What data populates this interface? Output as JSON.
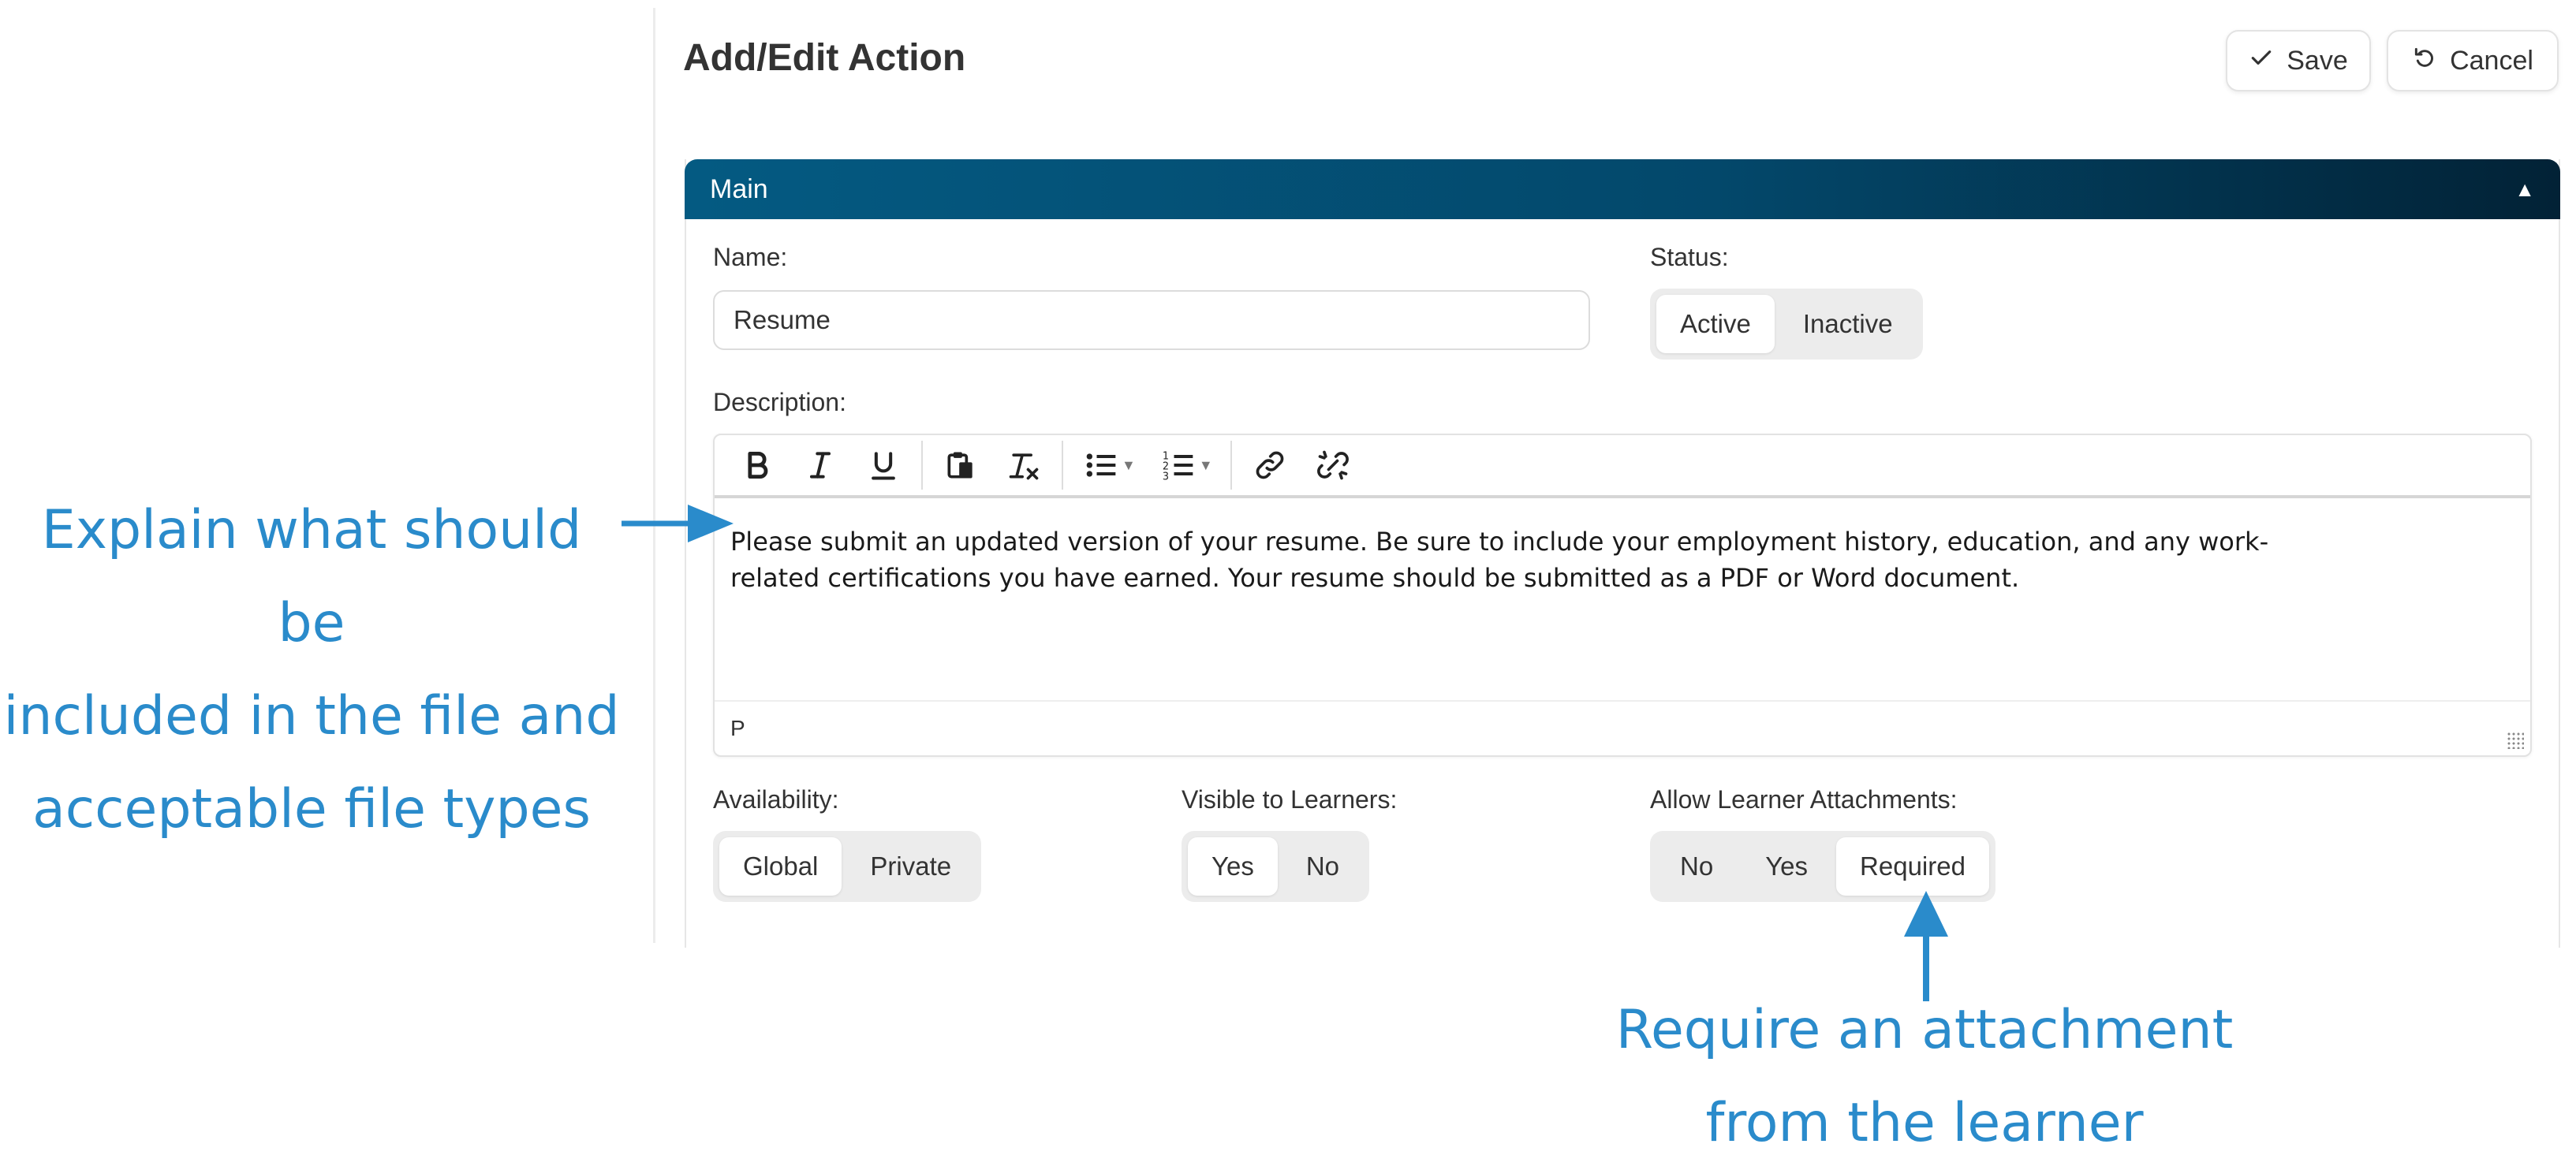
{
  "page": {
    "title": "Add/Edit Action"
  },
  "toolbar": {
    "save_label": "Save",
    "cancel_label": "Cancel"
  },
  "card": {
    "header": "Main"
  },
  "name": {
    "label": "Name:",
    "value": "Resume"
  },
  "status": {
    "label": "Status:",
    "options": [
      "Active",
      "Inactive"
    ],
    "selected": "Active"
  },
  "description": {
    "label": "Description:",
    "text_line1": "Please submit an updated version of your resume. Be sure to include your employment history, education, and any work-",
    "text_line2": "related certifications you have earned. Your resume should be submitted as a PDF or Word document.",
    "status_path": "P",
    "toolbar_icons": [
      "bold-icon",
      "italic-icon",
      "underline-icon",
      "paste-icon",
      "clear-formatting-icon",
      "bulleted-list-icon",
      "numbered-list-icon",
      "link-icon",
      "unlink-icon"
    ]
  },
  "availability": {
    "label": "Availability:",
    "options": [
      "Global",
      "Private"
    ],
    "selected": "Global"
  },
  "visible": {
    "label": "Visible to Learners:",
    "options": [
      "Yes",
      "No"
    ],
    "selected": "Yes"
  },
  "attachments": {
    "label": "Allow Learner Attachments:",
    "options": [
      "No",
      "Yes",
      "Required"
    ],
    "selected": "Required"
  },
  "annotations": {
    "left_line1": "Explain what should be",
    "left_line2": "included in the file and",
    "left_line3": "acceptable file types",
    "bottom_line1": "Require an attachment",
    "bottom_line2": "from the learner",
    "color": "#2a8bcb"
  },
  "colors": {
    "header_start": "#045a82",
    "header_end": "#022236"
  }
}
